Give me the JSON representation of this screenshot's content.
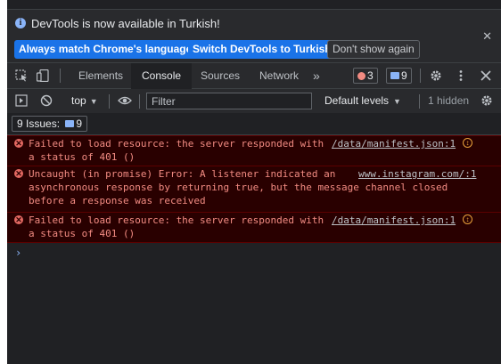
{
  "infobar": {
    "message": "DevTools is now available in Turkish!",
    "buttons": {
      "match_language": "Always match Chrome's language",
      "switch_language": "Switch DevTools to Turkish",
      "dont_show": "Don't show again"
    },
    "close_glyph": "✕"
  },
  "tabs": {
    "items": [
      "Elements",
      "Console",
      "Sources",
      "Network"
    ],
    "active": "Console",
    "more_glyph": "»",
    "error_count": "3",
    "message_count": "9"
  },
  "console_toolbar": {
    "context": "top",
    "filter_placeholder": "Filter",
    "levels": "Default levels",
    "hidden": "1 hidden"
  },
  "issues": {
    "label": "9 Issues:",
    "count": "9"
  },
  "messages": [
    {
      "text": "Failed to load resource: the server responded with\na status of 401 ()",
      "source": "/data/manifest.json:1",
      "has_source_icon": true
    },
    {
      "text": "Uncaught (in promise) Error: A listener indicated an\nasynchronous response by returning true, but the message channel closed\nbefore a response was received",
      "source": "www.instagram.com/:1",
      "has_source_icon": false
    },
    {
      "text": "Failed to load resource: the server responded with\na status of 401 ()",
      "source": "/data/manifest.json:1",
      "has_source_icon": true
    }
  ],
  "prompt_glyph": "›",
  "colors": {
    "background": "#202124",
    "toolbar": "#292a2d",
    "primary_button": "#1a73e8",
    "error_background": "#290000",
    "error_text": "#f28b82",
    "info_icon": "#8ab4f8"
  }
}
